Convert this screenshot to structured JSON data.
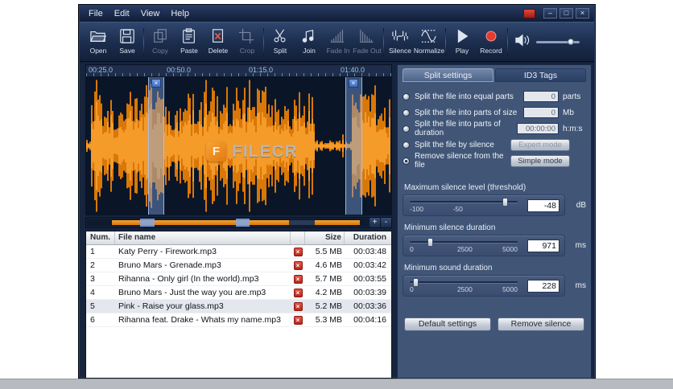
{
  "titlebar": {
    "menus": [
      {
        "label": "File"
      },
      {
        "label": "Edit"
      },
      {
        "label": "View"
      },
      {
        "label": "Help"
      }
    ],
    "controls": {
      "minimize": "–",
      "maximize": "□",
      "close": "×"
    }
  },
  "toolbar": {
    "items": [
      {
        "label": "Open",
        "icon": "open-folder-icon",
        "disabled": false
      },
      {
        "label": "Save",
        "icon": "save-floppy-icon",
        "disabled": false
      },
      {
        "label": "Copy",
        "icon": "copy-icon",
        "disabled": true
      },
      {
        "label": "Paste",
        "icon": "paste-clipboard-icon",
        "disabled": false
      },
      {
        "label": "Delete",
        "icon": "delete-page-icon",
        "disabled": false
      },
      {
        "label": "Crop",
        "icon": "crop-icon",
        "disabled": true
      },
      {
        "label": "Split",
        "icon": "scissors-icon",
        "disabled": false
      },
      {
        "label": "Join",
        "icon": "music-notes-icon",
        "disabled": false
      },
      {
        "label": "Fade In",
        "icon": "fade-in-icon",
        "disabled": true
      },
      {
        "label": "Fade Out",
        "icon": "fade-out-icon",
        "disabled": true
      },
      {
        "label": "Silence",
        "icon": "silence-wave-icon",
        "disabled": false
      },
      {
        "label": "Normalize",
        "icon": "normalize-wave-icon",
        "disabled": false
      },
      {
        "label": "Play",
        "icon": "play-icon",
        "disabled": false
      },
      {
        "label": "Record",
        "icon": "record-icon",
        "disabled": false
      }
    ],
    "volume_percent": 72
  },
  "timeline": {
    "ticks": [
      "00:25.0",
      "00:50.0",
      "01:15.0",
      "01:40.0"
    ]
  },
  "waveform": {
    "marker_symbol": "×"
  },
  "overview": {
    "zoom_in_label": "+",
    "zoom_out_label": "-"
  },
  "file_list": {
    "headers": {
      "num": "Num.",
      "name": "File name",
      "size": "Size",
      "duration": "Duration"
    },
    "delete_symbol": "×",
    "rows": [
      {
        "num": "1",
        "name": "Katy Perry - Firework.mp3",
        "size": "5.5 MB",
        "duration": "00:03:48",
        "selected": false
      },
      {
        "num": "2",
        "name": "Bruno Mars - Grenade.mp3",
        "size": "4.6 MB",
        "duration": "00:03:42",
        "selected": false
      },
      {
        "num": "3",
        "name": "Rihanna - Only girl (In the world).mp3",
        "size": "5.7 MB",
        "duration": "00:03:55",
        "selected": false
      },
      {
        "num": "4",
        "name": "Bruno Mars - Just the way you are.mp3",
        "size": "4.2 MB",
        "duration": "00:03:39",
        "selected": false
      },
      {
        "num": "5",
        "name": "Pink - Raise your glass.mp3",
        "size": "5.2 MB",
        "duration": "00:03:36",
        "selected": true
      },
      {
        "num": "6",
        "name": "Rihanna feat. Drake - Whats my name.mp3",
        "size": "5.3 MB",
        "duration": "00:04:16",
        "selected": false
      }
    ]
  },
  "settings": {
    "tabs": [
      {
        "label": "Split settings",
        "active": true
      },
      {
        "label": "ID3 Tags",
        "active": false
      }
    ],
    "options": [
      {
        "label": "Split the file into equal parts",
        "value": "0",
        "unit": "parts",
        "selected": false
      },
      {
        "label": "Split the file into parts of size",
        "value": "0",
        "unit": "Mb",
        "selected": false
      },
      {
        "label": "Split the file into parts of duration",
        "value": "00:00:00",
        "unit": "h:m:s",
        "selected": false
      },
      {
        "label": "Split the file by silence",
        "button": "Expert mode",
        "button_disabled": true,
        "selected": false
      },
      {
        "label": "Remove silence from the file",
        "button": "Simple mode",
        "button_disabled": false,
        "selected": true
      }
    ],
    "sliders": [
      {
        "label": "Maximum silence level (threshold)",
        "ticks": [
          "-100",
          "-50"
        ],
        "value": "-48",
        "unit": "dB",
        "percent": 88
      },
      {
        "label": "Minimum silence duration",
        "ticks": [
          "0",
          "2500",
          "5000"
        ],
        "value": "971",
        "unit": "ms",
        "percent": 19
      },
      {
        "label": "Minimum sound duration",
        "ticks": [
          "0",
          "2500",
          "5000"
        ],
        "value": "228",
        "unit": "ms",
        "percent": 5
      }
    ],
    "buttons": [
      {
        "label": "Default settings"
      },
      {
        "label": "Remove silence"
      }
    ]
  },
  "watermark": {
    "logo_letter": "F",
    "text": "FILECR"
  },
  "colors": {
    "waveform_orange": "#e8830f",
    "selection_blue": "#7da2dc",
    "panel_blue": "#415677",
    "delete_red": "#c6352a",
    "record_red": "#e23b30"
  }
}
